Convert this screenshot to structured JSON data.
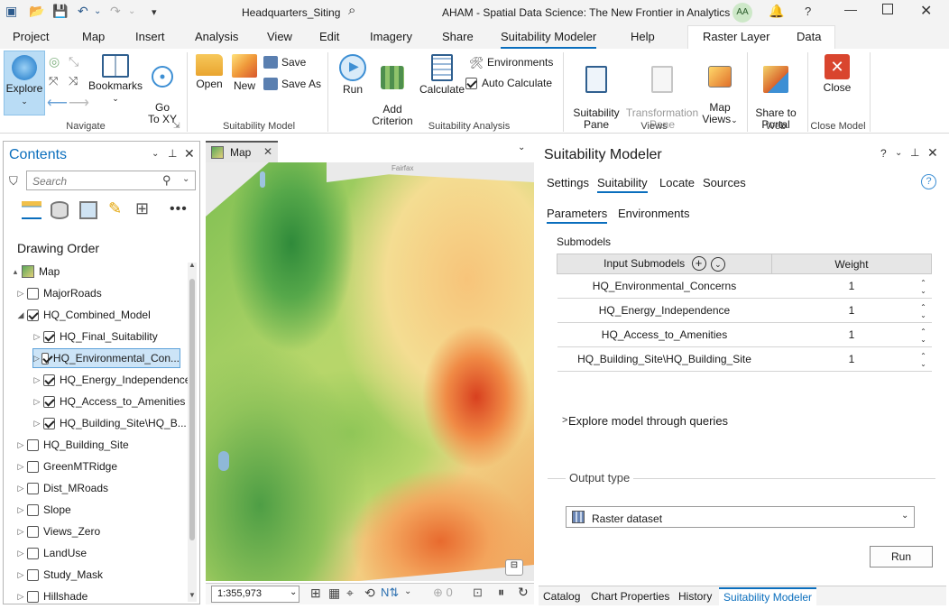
{
  "titlebar": {
    "project": "Headquarters_Siting",
    "app_title": "AHAM - Spatial Data Science:  The New Frontier in Analytics",
    "user": "AA"
  },
  "tabs": [
    "Project",
    "Map",
    "Insert",
    "Analysis",
    "View",
    "Edit",
    "Imagery",
    "Share",
    "Suitability Modeler",
    "Help"
  ],
  "context_tabs": [
    "Raster Layer",
    "Data"
  ],
  "ribbon": {
    "navigate": {
      "explore": "Explore",
      "bookmarks": "Bookmarks",
      "go_to_xy": "Go\nTo XY",
      "group": "Navigate"
    },
    "model": {
      "open": "Open",
      "new": "New",
      "save": "Save",
      "save_as": "Save As",
      "group": "Suitability Model"
    },
    "analysis": {
      "run": "Run",
      "add_criterion": "Add\nCriterion",
      "calculate": "Calculate",
      "environments": "Environments",
      "auto_calculate": "Auto Calculate",
      "group": "Suitability Analysis"
    },
    "views": {
      "suitability_pane": "Suitability\nPane",
      "transformation_pane": "Transformation\nPane",
      "map_views": "Map\nViews",
      "group": "Views"
    },
    "web": {
      "share_to_portal": "Share to\nPortal",
      "group": "Web"
    },
    "close": {
      "close": "Close",
      "group": "Close Model"
    }
  },
  "contents": {
    "title": "Contents",
    "search_placeholder": "Search",
    "drawing_order": "Drawing Order",
    "layers": [
      {
        "name": "Map",
        "indent": 0,
        "check": "map",
        "expand": "▴"
      },
      {
        "name": "MajorRoads",
        "indent": 1,
        "check": false,
        "expand": "▷"
      },
      {
        "name": "HQ_Combined_Model",
        "indent": 1,
        "check": true,
        "expand": "◢"
      },
      {
        "name": "HQ_Final_Suitability",
        "indent": 2,
        "check": true,
        "expand": "▷"
      },
      {
        "name": "HQ_Environmental_Con...",
        "indent": 2,
        "check": true,
        "expand": "▷",
        "selected": true
      },
      {
        "name": "HQ_Energy_Independence",
        "indent": 2,
        "check": true,
        "expand": "▷"
      },
      {
        "name": "HQ_Access_to_Amenities",
        "indent": 2,
        "check": true,
        "expand": "▷"
      },
      {
        "name": "HQ_Building_Site\\HQ_B...",
        "indent": 2,
        "check": true,
        "expand": "▷"
      },
      {
        "name": "HQ_Building_Site",
        "indent": 1,
        "check": false,
        "expand": "▷"
      },
      {
        "name": "GreenMTRidge",
        "indent": 1,
        "check": false,
        "expand": "▷"
      },
      {
        "name": "Dist_MRoads",
        "indent": 1,
        "check": false,
        "expand": "▷"
      },
      {
        "name": "Slope",
        "indent": 1,
        "check": false,
        "expand": "▷"
      },
      {
        "name": "Views_Zero",
        "indent": 1,
        "check": false,
        "expand": "▷"
      },
      {
        "name": "LandUse",
        "indent": 1,
        "check": false,
        "expand": "▷"
      },
      {
        "name": "Study_Mask",
        "indent": 1,
        "check": false,
        "expand": "▷"
      },
      {
        "name": "Hillshade",
        "indent": 1,
        "check": false,
        "expand": "▷"
      }
    ]
  },
  "map": {
    "tab": "Map",
    "scale": "1:355,973",
    "place_label": "Fairfax"
  },
  "suitability": {
    "title": "Suitability Modeler",
    "tabs": [
      "Settings",
      "Suitability",
      "Locate",
      "Sources"
    ],
    "active_tab": "Suitability",
    "subtabs": [
      "Parameters",
      "Environments"
    ],
    "submodels_label": "Submodels",
    "col_input": "Input Submodels",
    "col_weight": "Weight",
    "rows": [
      {
        "name": "HQ_Environmental_Concerns",
        "weight": "1"
      },
      {
        "name": "HQ_Energy_Independence",
        "weight": "1"
      },
      {
        "name": "HQ_Access_to_Amenities",
        "weight": "1"
      },
      {
        "name": "HQ_Building_Site\\HQ_Building_Site",
        "weight": "1"
      }
    ],
    "explore": "Explore model through queries",
    "output_type_label": "Output type",
    "output_type_value": "Raster dataset",
    "run": "Run"
  },
  "bottom_tabs": [
    "Catalog",
    "Chart Properties",
    "History",
    "Suitability Modeler"
  ],
  "colors": {
    "accent": "#0a6ebd",
    "selected_bg": "#cce4f7",
    "explore_bg": "#b9dcf5"
  }
}
